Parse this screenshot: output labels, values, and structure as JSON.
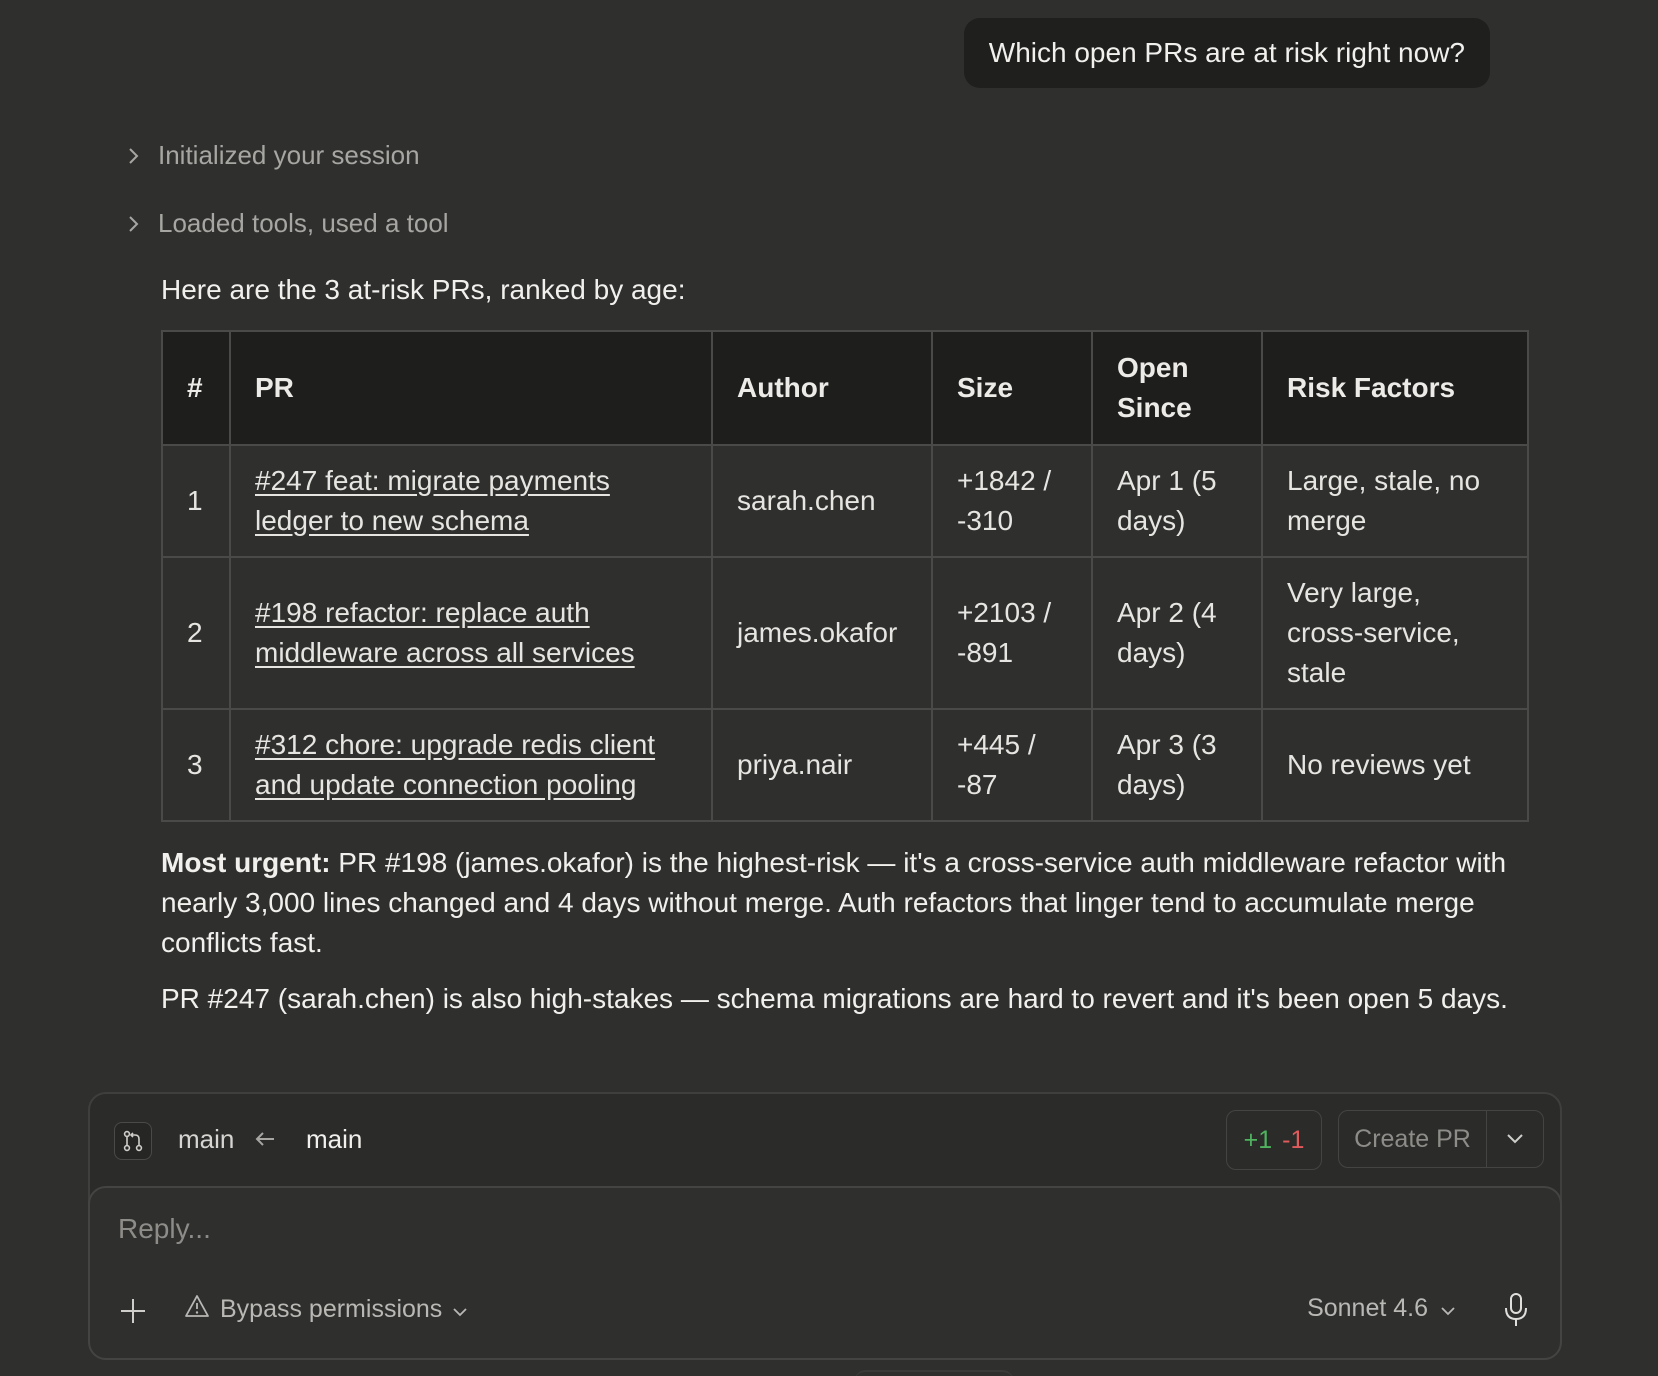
{
  "user_message": "Which open PRs are at risk right now?",
  "steps": [
    {
      "label": "Initialized your session",
      "icon": "chevron-right-icon"
    },
    {
      "label": "Loaded tools, used a tool",
      "icon": "chevron-right-icon"
    }
  ],
  "intro": "Here are the 3 at-risk PRs, ranked by age:",
  "table": {
    "headers": {
      "num": "#",
      "pr": "PR",
      "author": "Author",
      "size": "Size",
      "open_since": "Open Since",
      "risk": "Risk Factors"
    },
    "rows": [
      {
        "num": "1",
        "pr": "#247 feat: migrate payments ledger to new schema",
        "author": "sarah.chen",
        "size": "+1842 / -310",
        "open_since": "Apr 1 (5 days)",
        "risk": "Large, stale, no merge"
      },
      {
        "num": "2",
        "pr": "#198 refactor: replace auth middleware across all services",
        "author": "james.okafor",
        "size": "+2103 / -891",
        "open_since": "Apr 2 (4 days)",
        "risk": "Very large, cross-service, stale"
      },
      {
        "num": "3",
        "pr": "#312 chore: upgrade redis client and update connection pooling",
        "author": "priya.nair",
        "size": "+445 / -87",
        "open_since": "Apr 3 (3 days)",
        "risk": "No reviews yet"
      }
    ]
  },
  "summary": {
    "urgent_label": "Most urgent:",
    "urgent_text": " PR #198 (james.okafor) is the highest-risk — it's a cross-service auth middleware refactor with nearly 3,000 lines changed and 4 days without merge. Auth refactors that linger tend to accumulate merge conflicts fast.",
    "second_text": "PR #247 (sarah.chen) is also high-stakes — schema migrations are hard to revert and it's been open 5 days."
  },
  "composer": {
    "branch_from": "main",
    "branch_to": "main",
    "diff_add": "+1",
    "diff_del": "-1",
    "create_pr_label": "Create PR",
    "reply_placeholder": "Reply...",
    "permissions_label": "Bypass permissions",
    "model_label": "Sonnet 4.6"
  },
  "colors": {
    "background": "#2f2f2e",
    "table_header_bg": "#1e1e1d",
    "diff_add": "#4fb35f",
    "diff_del": "#e05c5c"
  }
}
